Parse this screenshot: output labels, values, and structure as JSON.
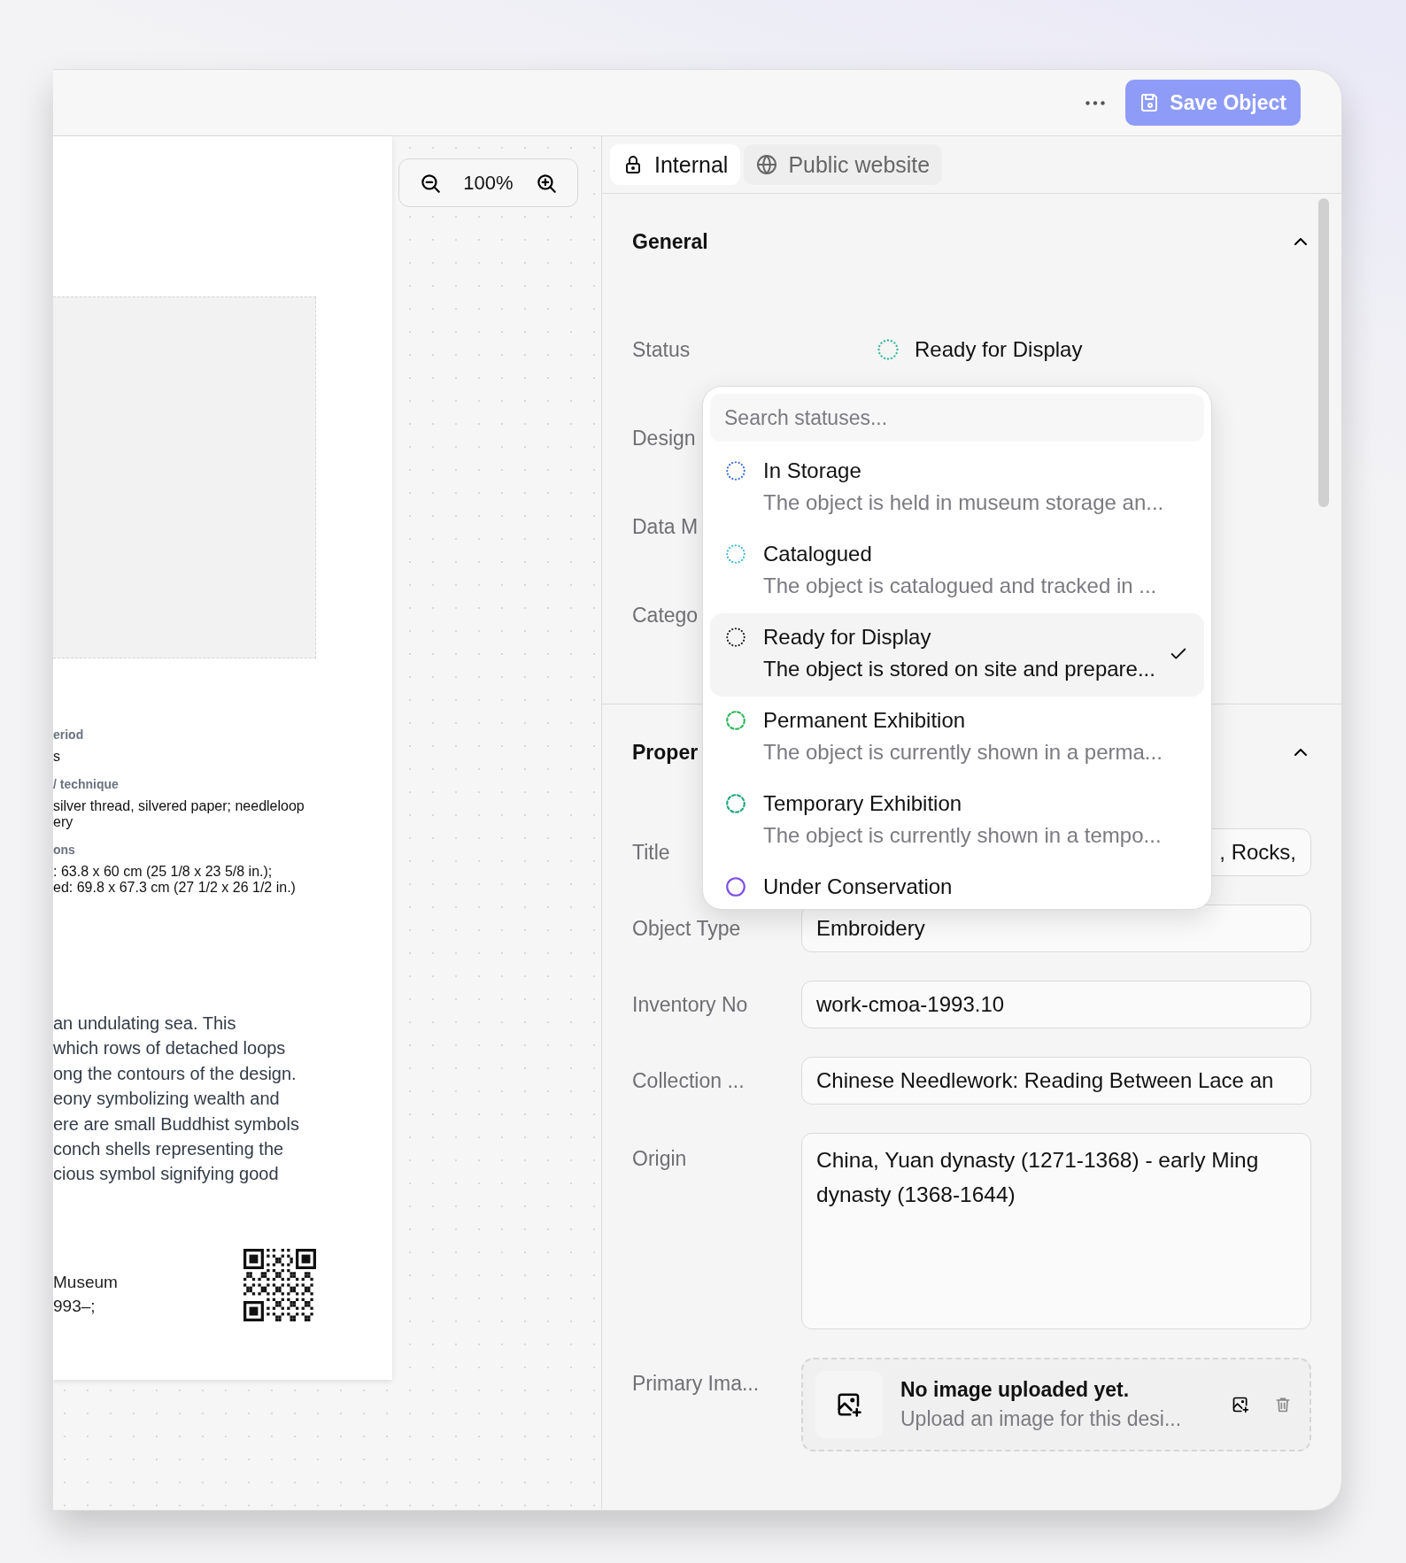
{
  "toolbar": {
    "save_button": "Save Object"
  },
  "preview": {
    "zoom": "100%",
    "lines": [
      {
        "kind": "label",
        "text": "eriod"
      },
      {
        "kind": "value",
        "text": "s"
      },
      {
        "kind": "label",
        "text": "/ technique"
      },
      {
        "kind": "value",
        "text": "silver thread, silvered paper; needleloop"
      },
      {
        "kind": "cont",
        "text": "ery"
      },
      {
        "kind": "label",
        "text": "ons"
      },
      {
        "kind": "value",
        "text": ": 63.8 x 60 cm (25 1/8 x 23 5/8 in.);"
      },
      {
        "kind": "cont",
        "text": "ed: 69.8 x 67.3 cm (27 1/2 x 26 1/2 in.)"
      }
    ],
    "paragraph": [
      "an undulating sea. This",
      "which rows of detached loops",
      "ong the contours of the design.",
      "eony symbolizing wealth and",
      "ere are small Buddhist symbols",
      "conch shells representing the",
      "cious symbol signifying good"
    ],
    "credit": [
      "Museum",
      "993–;"
    ]
  },
  "tabs": [
    {
      "label": "Internal",
      "kind": "lock",
      "selected": true
    },
    {
      "label": "Public website",
      "kind": "globe",
      "selected": false
    }
  ],
  "general": {
    "title": "General",
    "expanded": true,
    "status": {
      "label": "Status",
      "value": "Ready for Display",
      "color": "#34b89a"
    },
    "labels": [
      "Design",
      "Data M",
      "Catego"
    ]
  },
  "properties": {
    "title": "Proper",
    "expanded": true,
    "fields": [
      {
        "kind": "input",
        "label": "Title",
        "value": ", Rocks,",
        "scrolled": true
      },
      {
        "kind": "input",
        "label": "Object Type",
        "value": "Embroidery",
        "scrolled": false
      },
      {
        "kind": "input",
        "label": "Inventory No",
        "value": "work-cmoa-1993.10",
        "scrolled": false
      },
      {
        "kind": "input",
        "label": "Collection ...",
        "value": "Chinese Needlework: Reading Between Lace an",
        "scrolled": false
      },
      {
        "kind": "textarea",
        "label": "Origin",
        "value": "China, Yuan dynasty (1271-1368) - early Ming dynasty (1368-1644)"
      },
      {
        "kind": "image",
        "label": "Primary Ima...",
        "title": "No image uploaded yet.",
        "hint": "Upload an image for this desi..."
      }
    ]
  },
  "status_menu": {
    "placeholder": "Search statuses...",
    "options": [
      {
        "name": "In Storage",
        "description": "The object is held in museum storage an...",
        "color": "#3b6fe0",
        "kind": "dotted",
        "selected": false
      },
      {
        "name": "Catalogued",
        "description": "The object is catalogued and tracked in ...",
        "color": "#3fb6d6",
        "kind": "dotted",
        "selected": false
      },
      {
        "name": "Ready for Display",
        "description": "The object is stored on site and prepare...",
        "color": "#222222",
        "kind": "dotted",
        "selected": true
      },
      {
        "name": "Permanent Exhibition",
        "description": "The object is currently shown in a perma...",
        "color": "#2fb85a",
        "kind": "dashed",
        "selected": false
      },
      {
        "name": "Temporary Exhibition",
        "description": "The object is currently shown in a tempo...",
        "color": "#22a87a",
        "kind": "dashed",
        "selected": false
      },
      {
        "name": "Under Conservation",
        "color": "#7c4de8",
        "kind": "solid",
        "selected": false
      }
    ]
  }
}
